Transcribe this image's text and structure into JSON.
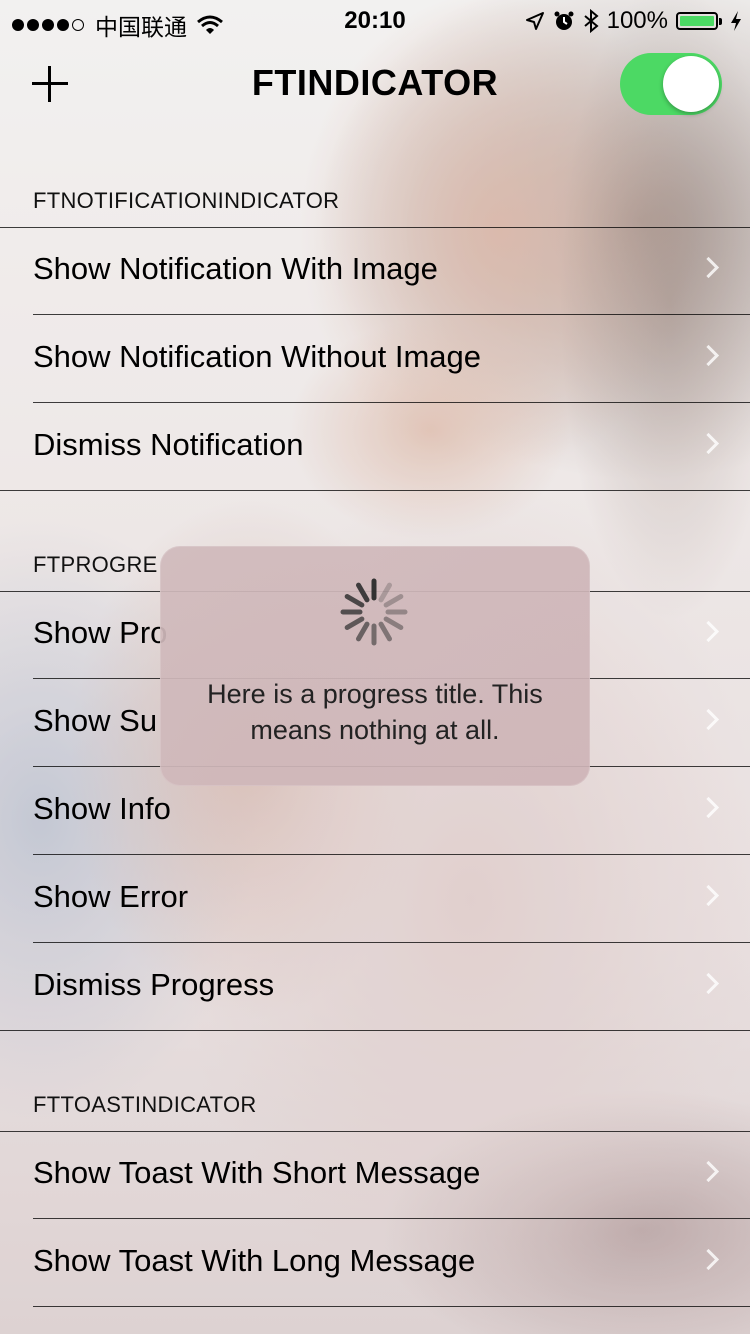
{
  "status_bar": {
    "carrier": "中国联通",
    "time": "20:10",
    "battery_percent": "100%"
  },
  "nav": {
    "title": "FTINDICATOR",
    "toggle_on": true
  },
  "sections": [
    {
      "header": "FTNOTIFICATIONINDICATOR",
      "rows": [
        "Show Notification With Image",
        "Show Notification Without Image",
        "Dismiss Notification"
      ]
    },
    {
      "header": "FTPROGRE",
      "rows": [
        "Show Pro",
        "Show Su",
        "Show Info",
        "Show Error",
        "Dismiss Progress"
      ]
    },
    {
      "header": "FTTOASTINDICATOR",
      "rows": [
        "Show Toast With Short Message",
        "Show Toast With Long Message"
      ]
    }
  ],
  "hud": {
    "line1": "Here is a progress title. This",
    "line2": "means nothing at all."
  },
  "colors": {
    "toggle_on": "#4cd964",
    "battery_fill": "#4cd964"
  }
}
